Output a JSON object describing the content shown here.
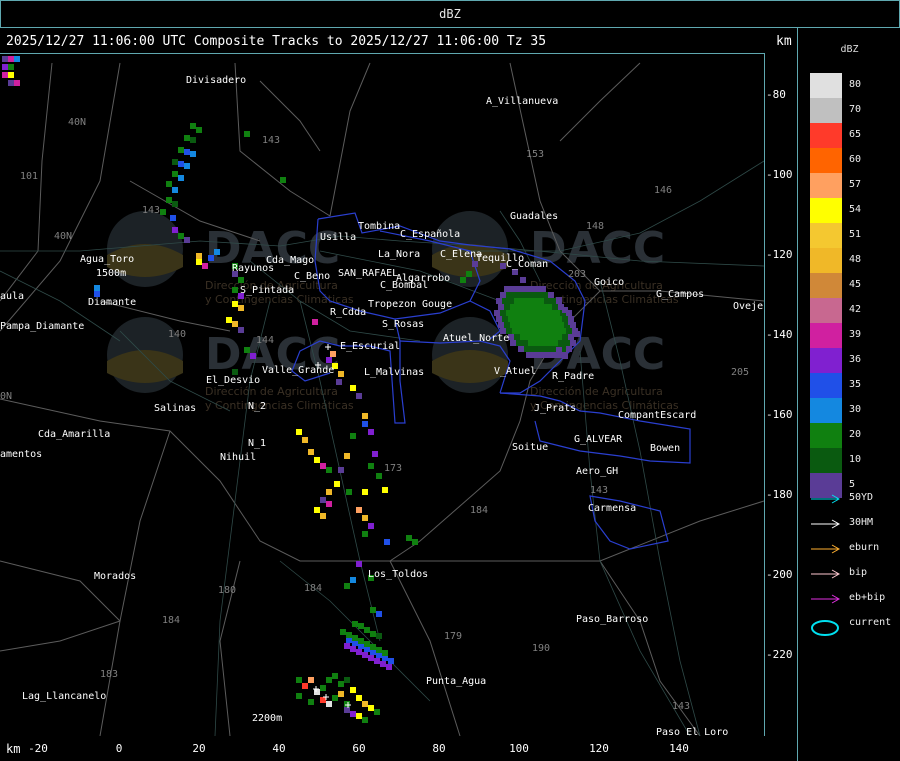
{
  "window": {
    "title": "dBZ"
  },
  "header": {
    "text": "2025/12/27 11:06:00 UTC Composite Tracks to 2025/12/27 11:06:00 Tz 35",
    "unit": "km"
  },
  "axis": {
    "x_unit": "km",
    "x_ticks": [
      "-20",
      "0",
      "20",
      "40",
      "60",
      "80",
      "100",
      "120",
      "140"
    ],
    "y_ticks": [
      "-80",
      "-100",
      "-120",
      "-140",
      "-160",
      "-180",
      "-200",
      "-220"
    ]
  },
  "legend": {
    "title": "dBZ",
    "items": [
      {
        "label": "80",
        "color": "#e0e0e0"
      },
      {
        "label": "70",
        "color": "#c0c0c0"
      },
      {
        "label": "65",
        "color": "#ff3a2a"
      },
      {
        "label": "60",
        "color": "#ff6400"
      },
      {
        "label": "57",
        "color": "#ffa060"
      },
      {
        "label": "54",
        "color": "#ffff00"
      },
      {
        "label": "51",
        "color": "#f4c830"
      },
      {
        "label": "48",
        "color": "#f0b828"
      },
      {
        "label": "45",
        "color": "#d08838"
      },
      {
        "label": "42",
        "color": "#c86890"
      },
      {
        "label": "39",
        "color": "#d020a0"
      },
      {
        "label": "36",
        "color": "#8020d0"
      },
      {
        "label": "35",
        "color": "#2050e8"
      },
      {
        "label": "30",
        "color": "#1488e0"
      },
      {
        "label": "20",
        "color": "#108010"
      },
      {
        "label": "10",
        "color": "#0a5a10"
      },
      {
        "label": "5",
        "color": "#5a3c96"
      }
    ],
    "tracks": [
      {
        "label": "50YD",
        "color": "#00e0f0",
        "icon": "arrow"
      },
      {
        "label": "30HM",
        "color": "#ffffff",
        "icon": "arrow"
      },
      {
        "label": "eburn",
        "color": "#ffb030",
        "icon": "arrow"
      },
      {
        "label": "bip",
        "color": "#ffc8d0",
        "icon": "arrow"
      },
      {
        "label": "eb+bip",
        "color": "#e030e0",
        "icon": "arrow"
      },
      {
        "label": "current",
        "color": "#00e0f0",
        "icon": "ellipse"
      }
    ]
  },
  "map": {
    "watermark": {
      "brand": "DACC",
      "line1": "Dirección de Agricultura",
      "line2": "y Contingencias Climáticas"
    },
    "places": [
      {
        "name": "Divisadero"
      },
      {
        "name": "A_Villanueva"
      },
      {
        "name": "Guadales"
      },
      {
        "name": "Tombina"
      },
      {
        "name": "Usilla"
      },
      {
        "name": "C_Española"
      },
      {
        "name": "La_Nora"
      },
      {
        "name": "C_Elena"
      },
      {
        "name": "Tequillo"
      },
      {
        "name": "C_Coman"
      },
      {
        "name": "Goico"
      },
      {
        "name": "G_Campos"
      },
      {
        "name": "Oveje"
      },
      {
        "name": "Agua_Toro"
      },
      {
        "name": "1500m"
      },
      {
        "name": "Rayunos"
      },
      {
        "name": "Cda_Mago"
      },
      {
        "name": "SAN_RAFAEL"
      },
      {
        "name": "C_Beno"
      },
      {
        "name": "Algarrobo"
      },
      {
        "name": "C_Bombal"
      },
      {
        "name": "Gouge"
      },
      {
        "name": "Tropezon"
      },
      {
        "name": "R_Cdda"
      },
      {
        "name": "S_Pintada"
      },
      {
        "name": "aula"
      },
      {
        "name": "Diamante"
      },
      {
        "name": "Pampa_Diamante"
      },
      {
        "name": "S_Rosas"
      },
      {
        "name": "Atuel_Norte"
      },
      {
        "name": "E_Escurial"
      },
      {
        "name": "El_Desvio"
      },
      {
        "name": "Valle_Grande"
      },
      {
        "name": "L_Malvinas"
      },
      {
        "name": "V_Atuel"
      },
      {
        "name": "R_Padre"
      },
      {
        "name": "Salinas"
      },
      {
        "name": "N_2"
      },
      {
        "name": "J_Prats"
      },
      {
        "name": "CompantEscard"
      },
      {
        "name": "Cda_Amarilla"
      },
      {
        "name": "N_1"
      },
      {
        "name": "Nihuil"
      },
      {
        "name": "Soitue"
      },
      {
        "name": "G_ALVEAR"
      },
      {
        "name": "Bowen"
      },
      {
        "name": "amentos"
      },
      {
        "name": "Aero_GH"
      },
      {
        "name": "Carmensa"
      },
      {
        "name": "Los_Toldos"
      },
      {
        "name": "Morados"
      },
      {
        "name": "Paso_Barroso"
      },
      {
        "name": "Punta_Agua"
      },
      {
        "name": "Lag_Llancanelo"
      },
      {
        "name": "2200m"
      },
      {
        "name": "Paso_El_Loro"
      }
    ],
    "route_numbers": [
      "40N",
      "101",
      "143",
      "153",
      "146",
      "148",
      "143",
      "40N",
      "203",
      "144",
      "140",
      "205",
      "0N",
      "173",
      "184",
      "180",
      "184",
      "179",
      "190",
      "184",
      "183",
      "143",
      "143"
    ]
  }
}
